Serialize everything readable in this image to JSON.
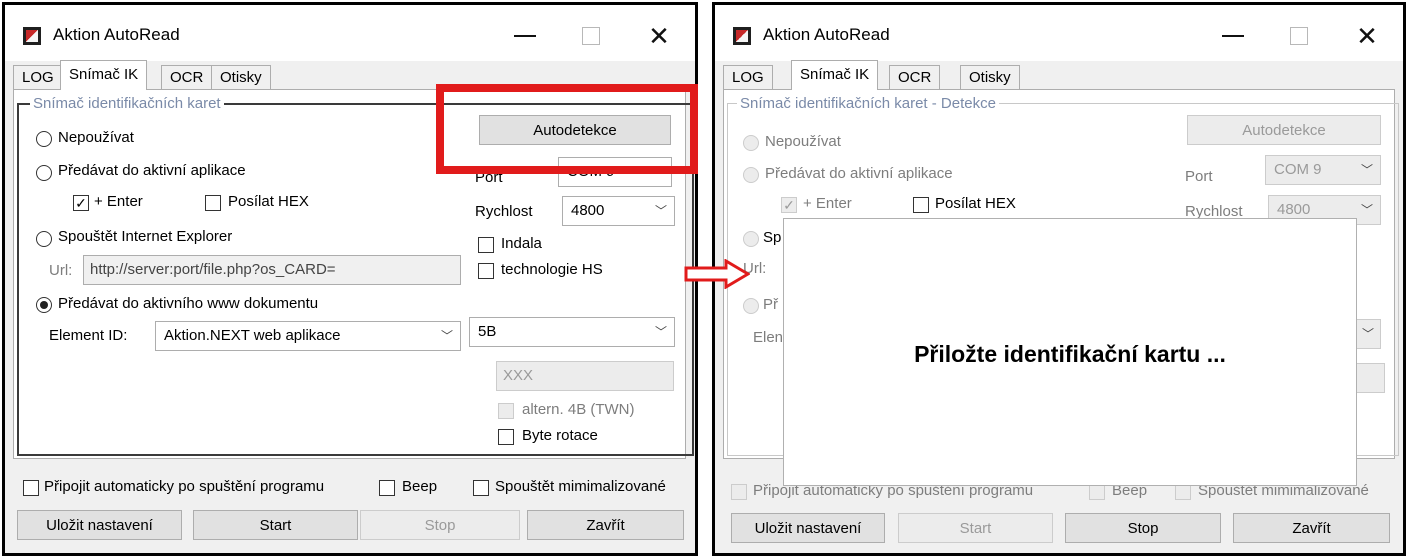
{
  "window_title": "Aktion AutoRead",
  "tabs": [
    "LOG",
    "Snímač IK",
    "OCR",
    "Otisky"
  ],
  "active_tab_index": 1,
  "left": {
    "group_title": "Snímač identifikačních karet",
    "radio_nepouzivat": "Nepoužívat",
    "radio_predavat_aktivni": "Předávat do aktivní aplikace",
    "chk_enter": "+ Enter",
    "chk_enter_checked": true,
    "chk_hex": "Posílat HEX",
    "chk_hex_checked": false,
    "radio_ie": "Spouštět Internet Explorer",
    "url_label": "Url:",
    "url_value": "http://server:port/file.php?os_CARD=",
    "radio_www": "Předávat do aktivního www dokumentu",
    "selected_radio": "www",
    "element_id_label": "Element ID:",
    "element_id_value": "Aktion.NEXT web aplikace",
    "autodetect_button": "Autodetekce",
    "port_label": "Port",
    "port_value": "COM 9",
    "speed_label": "Rychlost",
    "speed_value": "4800",
    "chk_indala": "Indala",
    "chk_hs": "technologie HS",
    "format_value": "5B",
    "xxx_value": "XXX",
    "chk_altern": "altern. 4B (TWN)",
    "chk_byte": "Byte rotace",
    "chk_auto_connect": "Připojit automaticky po spuštění programu",
    "chk_beep": "Beep",
    "chk_minimized": "Spouštět mimimalizované",
    "btn_save": "Uložit nastavení",
    "btn_start": "Start",
    "btn_stop": "Stop",
    "btn_close": "Zavřít"
  },
  "right": {
    "group_title": "Snímač identifikačních karet   - Detekce",
    "radio_nepouzivat": "Nepoužívat",
    "radio_predavat_aktivni": "Předávat do aktivní aplikace",
    "chk_enter": "+ Enter",
    "chk_hex": "Posílat HEX",
    "radio_ie_partial": "Sp",
    "url_partial": "Url:",
    "radio_www_partial": "Př",
    "element_partial": "Elen",
    "autodetect_button": "Autodetekce",
    "port_label": "Port",
    "port_value": "COM 9",
    "speed_label": "Rychlost",
    "speed_value": "4800",
    "modal_message": "Přiložte identifikační kartu ...",
    "chk_auto_connect": "Připojit automaticky po spuštění programu",
    "chk_beep": "Beep",
    "chk_minimized": "Spouštět mimimalizované",
    "btn_save": "Uložit nastavení",
    "btn_start": "Start",
    "btn_stop": "Stop",
    "btn_close": "Zavřít"
  },
  "colors": {
    "highlight": "#e11b1b",
    "group_title": "#7a8aa8"
  },
  "icons": {
    "app": "app-icon",
    "minimize": "minimize-icon",
    "maximize": "maximize-icon",
    "close": "close-icon",
    "dropdown": "chevron-down-icon",
    "arrow": "arrow-right-icon"
  }
}
